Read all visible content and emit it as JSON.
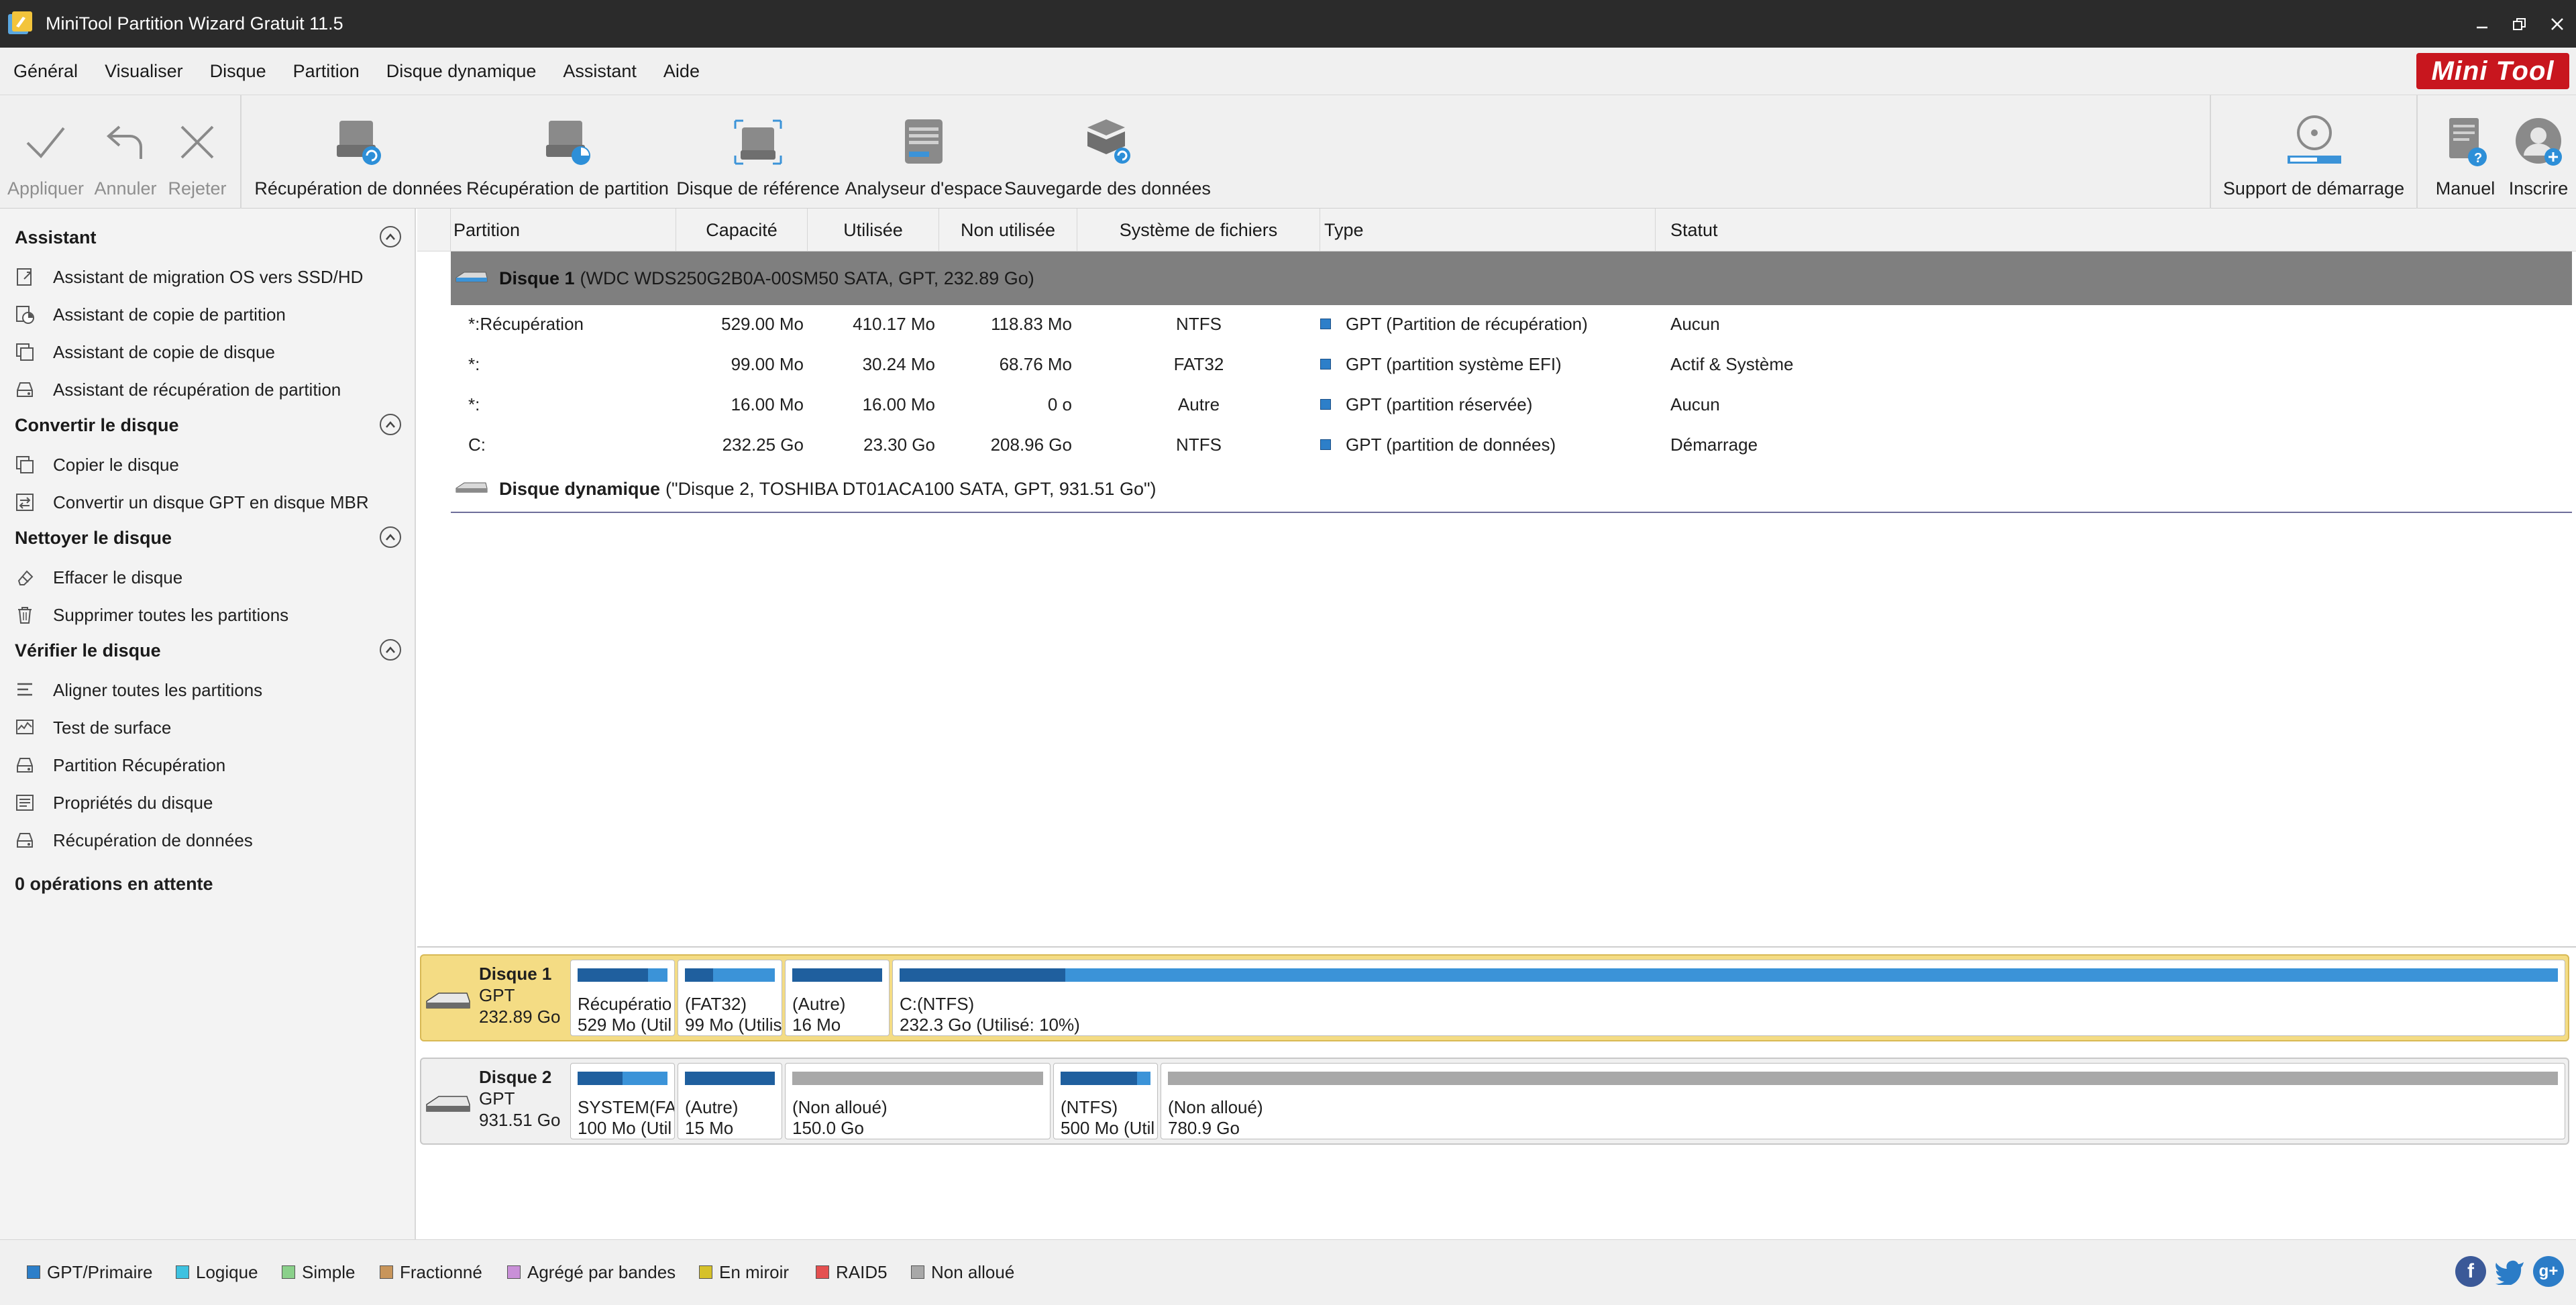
{
  "window": {
    "title": "MiniTool Partition Wizard Gratuit 11.5",
    "brand": "Mini Tool"
  },
  "menu": {
    "items": [
      "Général",
      "Visualiser",
      "Disque",
      "Partition",
      "Disque dynamique",
      "Assistant",
      "Aide"
    ]
  },
  "toolbar": {
    "apply": "Appliquer",
    "undo": "Annuler",
    "discard": "Rejeter",
    "data_recovery": "Récupération de données",
    "partition_recovery": "Récupération de partition",
    "disk_benchmark": "Disque de référence",
    "space_analyzer": "Analyseur d'espace",
    "data_backup": "Sauvegarde des données",
    "bootable_media": "Support de démarrage",
    "manual": "Manuel",
    "register": "Inscrire"
  },
  "sidebar": {
    "sections": [
      {
        "title": "Assistant",
        "items": [
          "Assistant de migration OS vers SSD/HD",
          "Assistant de copie de partition",
          "Assistant de copie de disque",
          "Assistant de récupération de partition"
        ]
      },
      {
        "title": "Convertir le disque",
        "items": [
          "Copier le disque",
          "Convertir un disque GPT en disque MBR"
        ]
      },
      {
        "title": "Nettoyer le disque",
        "items": [
          "Effacer le disque",
          "Supprimer toutes les partitions"
        ]
      },
      {
        "title": "Vérifier le disque",
        "items": [
          "Aligner toutes les partitions",
          "Test de surface",
          "Partition Récupération",
          "Propriétés du disque",
          "Récupération de données"
        ]
      }
    ],
    "pending": "0 opérations en attente"
  },
  "table": {
    "headers": [
      "Partition",
      "Capacité",
      "Utilisée",
      "Non utilisée",
      "Système de fichiers",
      "Type",
      "Statut"
    ],
    "disk1": {
      "name": "Disque 1",
      "desc": "(WDC WDS250G2B0A-00SM50 SATA, GPT, 232.89 Go)"
    },
    "rows": [
      {
        "partition": "*:Récupération",
        "capacity": "529.00 Mo",
        "used": "410.17 Mo",
        "unused": "118.83 Mo",
        "fs": "NTFS",
        "type": "GPT (Partition de récupération)",
        "status": "Aucun"
      },
      {
        "partition": "*:",
        "capacity": "99.00 Mo",
        "used": "30.24 Mo",
        "unused": "68.76 Mo",
        "fs": "FAT32",
        "type": "GPT (partition système EFI)",
        "status": "Actif & Système"
      },
      {
        "partition": "*:",
        "capacity": "16.00 Mo",
        "used": "16.00 Mo",
        "unused": "0 o",
        "fs": "Autre",
        "type": "GPT (partition réservée)",
        "status": "Aucun"
      },
      {
        "partition": "C:",
        "capacity": "232.25 Go",
        "used": "23.30 Go",
        "unused": "208.96 Go",
        "fs": "NTFS",
        "type": "GPT (partition de données)",
        "status": "Démarrage"
      }
    ],
    "dyn": {
      "name": "Disque dynamique",
      "desc": "(\"Disque 2, TOSHIBA DT01ACA100 SATA, GPT, 931.51 Go\")"
    }
  },
  "diskmap": {
    "disk1": {
      "name": "Disque 1",
      "style": "GPT",
      "size": "232.89 Go",
      "segments": [
        {
          "l1": "Récupératio",
          "l2": "529 Mo (Util",
          "used": 0.78,
          "kind": "primary"
        },
        {
          "l1": "(FAT32)",
          "l2": "99 Mo (Utilis",
          "used": 0.31,
          "kind": "primary"
        },
        {
          "l1": "(Autre)",
          "l2": "16 Mo",
          "used": 1.0,
          "kind": "primary"
        },
        {
          "l1": "C:(NTFS)",
          "l2": "232.3 Go (Utilisé: 10%)",
          "used": 0.1,
          "kind": "primary"
        }
      ]
    },
    "disk2": {
      "name": "Disque 2",
      "style": "GPT",
      "size": "931.51 Go",
      "segments": [
        {
          "l1": "SYSTEM(FAT",
          "l2": "100 Mo (Util",
          "used": 0.5,
          "kind": "primary"
        },
        {
          "l1": "(Autre)",
          "l2": "15 Mo",
          "used": 1.0,
          "kind": "primary"
        },
        {
          "l1": "(Non alloué)",
          "l2": "150.0 Go",
          "used": 0,
          "kind": "unallocated"
        },
        {
          "l1": "(NTFS)",
          "l2": "500 Mo (Util",
          "used": 0.85,
          "kind": "primary"
        },
        {
          "l1": "(Non alloué)",
          "l2": "780.9 Go",
          "used": 0,
          "kind": "unallocated"
        }
      ]
    }
  },
  "legend": {
    "items": [
      {
        "label": "GPT/Primaire",
        "color": "#2d7fc9"
      },
      {
        "label": "Logique",
        "color": "#3ec2e0"
      },
      {
        "label": "Simple",
        "color": "#8ad08a"
      },
      {
        "label": "Fractionné",
        "color": "#c8955a"
      },
      {
        "label": "Agrégé par bandes",
        "color": "#c990d8"
      },
      {
        "label": "En miroir",
        "color": "#d6c12a"
      },
      {
        "label": "RAID5",
        "color": "#e45050"
      },
      {
        "label": "Non alloué",
        "color": "#a8a8a8"
      }
    ]
  },
  "colors": {
    "primary_fill": "#1f5f9e",
    "primary_bar": "#3b93d8",
    "unalloc_bar": "#a8a8a8",
    "selected_row": "#7f7f7f",
    "selected_disk": "#f4dc84"
  }
}
